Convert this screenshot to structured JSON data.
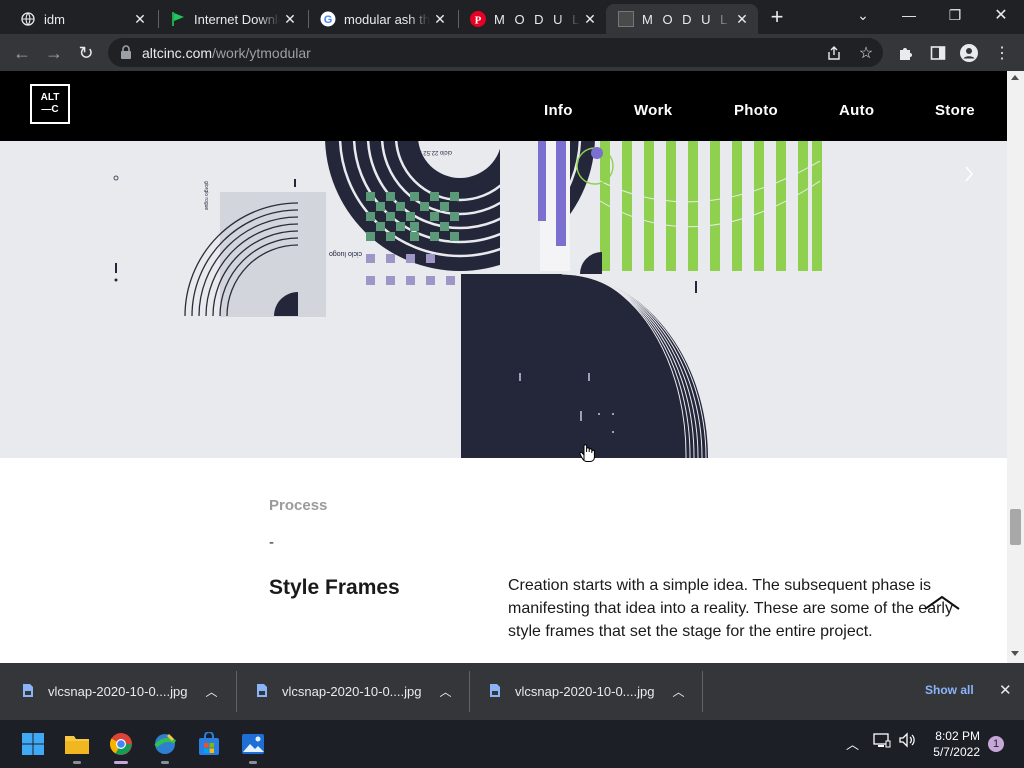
{
  "tabs": [
    {
      "label": "idm",
      "icon": "globe-icon",
      "active": false
    },
    {
      "label": "Internet Download Manager",
      "icon": "idm-flag-icon",
      "active": false
    },
    {
      "label": "modular ash thompson",
      "icon": "google-icon",
      "active": false
    },
    {
      "label": "M O D U L A R - Ash Thompson",
      "icon": "pinterest-icon",
      "active": false
    },
    {
      "label": "M O D U L A R - ALTC",
      "icon": "altc-favicon",
      "active": true
    }
  ],
  "address": {
    "domain": "altcinc.com",
    "path": "/work/ytmodular"
  },
  "site": {
    "logo_line1": "ALT",
    "logo_line2": "—C",
    "nav": [
      "Info",
      "Work",
      "Photo",
      "Auto",
      "Store"
    ]
  },
  "content": {
    "label": "Process",
    "dash": "-",
    "heading": "Style Frames",
    "description": "Creation starts with a simple idea.  The subsequent phase is manifesting that idea into a reality.  These are some of the early style frames that set the stage for the entire project."
  },
  "downloads": {
    "items": [
      "vlcsnap-2020-10-0....jpg",
      "vlcsnap-2020-10-0....jpg",
      "vlcsnap-2020-10-0....jpg"
    ],
    "show_all": "Show all"
  },
  "taskbar": {
    "time": "8:02 PM",
    "date": "5/7/2022",
    "notifications": "1"
  },
  "colors": {
    "accent_green": "#8fd14f",
    "accent_purple": "#7b6fd0",
    "dark_navy": "#24263a",
    "teal": "#5a9a78"
  }
}
